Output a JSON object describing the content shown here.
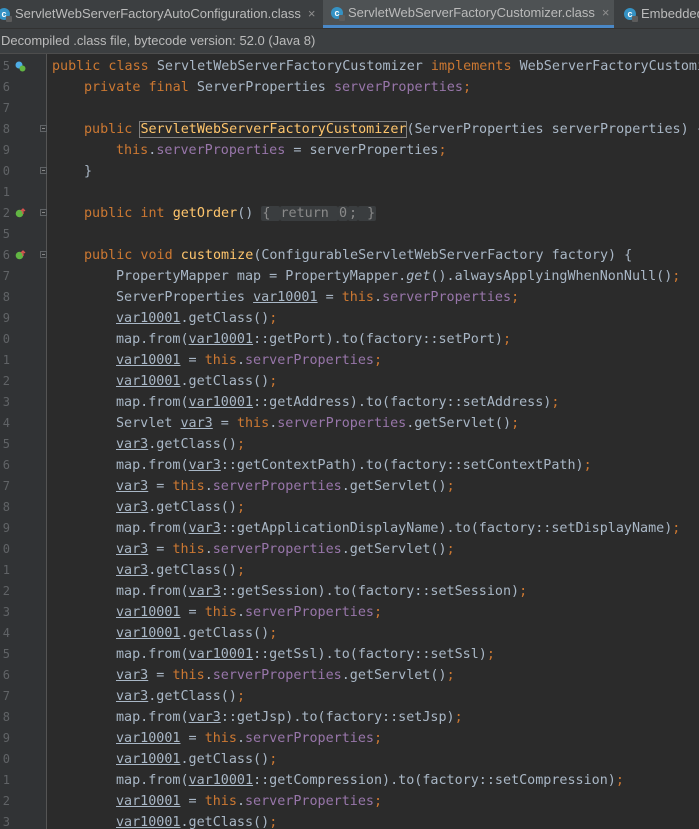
{
  "tabs": [
    {
      "label": "ServletWebServerFactoryAutoConfiguration.class",
      "active": false,
      "icon": "class-file-icon"
    },
    {
      "label": "ServletWebServerFactoryCustomizer.class",
      "active": true,
      "icon": "class-file-icon"
    },
    {
      "label": "EmbeddedServletContainerAutoConfiguration.class",
      "active": false,
      "icon": "class-file-icon"
    }
  ],
  "tab_close_glyph": "×",
  "tab_icon_glyph": "c",
  "banner": "Decompiled .class file, bytecode version: 52.0 (Java 8)",
  "colors": {
    "keyword": "#cc7832",
    "method": "#ffc66d",
    "field": "#9876aa",
    "number": "#6897bb",
    "text": "#a9b7c6",
    "background": "#2b2b2b",
    "accent": "#4a88c7"
  },
  "code_lines": [
    {
      "n": "15",
      "indent": 0,
      "tokens": [
        [
          "kw",
          "public class "
        ],
        [
          "t",
          "ServletWebServerFactoryCustomizer "
        ],
        [
          "kw",
          "implements "
        ],
        [
          "t",
          "WebServerFactoryCustomizer<ConfigurableServletWebServerFactory>, Ordered {"
        ]
      ]
    },
    {
      "n": "16",
      "indent": 1,
      "tokens": [
        [
          "kw",
          "private final "
        ],
        [
          "t",
          "ServerProperties "
        ],
        [
          "fld",
          "serverProperties"
        ],
        [
          "kw",
          ";"
        ]
      ]
    },
    {
      "n": "17",
      "indent": 0,
      "tokens": []
    },
    {
      "n": "18",
      "indent": 1,
      "tokens": [
        [
          "kw",
          "public "
        ],
        [
          "fn",
          "ServletWebServerFactoryCustomizer"
        ],
        [
          "t",
          "(ServerProperties serverProperties) {"
        ]
      ]
    },
    {
      "n": "19",
      "indent": 2,
      "tokens": [
        [
          "kw",
          "this"
        ],
        [
          "t",
          "."
        ],
        [
          "fld",
          "serverProperties"
        ],
        [
          "t",
          " = serverProperties"
        ],
        [
          "kw",
          ";"
        ]
      ]
    },
    {
      "n": "20",
      "indent": 1,
      "tokens": [
        [
          "t",
          "}"
        ]
      ]
    },
    {
      "n": "21",
      "indent": 0,
      "tokens": []
    },
    {
      "n": "22",
      "indent": 1,
      "tokens": [
        [
          "kw",
          "public int "
        ],
        [
          "fn",
          "getOrder"
        ],
        [
          "t",
          "() "
        ],
        [
          "col",
          "{ "
        ],
        [
          "kwc",
          "return "
        ],
        [
          "numc",
          "0"
        ],
        [
          "kwc",
          ";"
        ],
        [
          "col",
          " }"
        ]
      ]
    },
    {
      "n": "25",
      "indent": 0,
      "tokens": []
    },
    {
      "n": "26",
      "indent": 1,
      "tokens": [
        [
          "kw",
          "public void "
        ],
        [
          "fn",
          "customize"
        ],
        [
          "t",
          "(ConfigurableServletWebServerFactory factory) {"
        ]
      ]
    },
    {
      "n": "27",
      "indent": 2,
      "tokens": [
        [
          "t",
          "PropertyMapper map = PropertyMapper."
        ],
        [
          "it",
          "get"
        ],
        [
          "t",
          "().alwaysApplyingWhenNonNull()"
        ],
        [
          "kw",
          ";"
        ]
      ]
    },
    {
      "n": "28",
      "indent": 2,
      "tokens": [
        [
          "t",
          "ServerProperties "
        ],
        [
          "var",
          "var10001"
        ],
        [
          "t",
          " = "
        ],
        [
          "kw",
          "this"
        ],
        [
          "t",
          "."
        ],
        [
          "fld",
          "serverProperties"
        ],
        [
          "kw",
          ";"
        ]
      ]
    },
    {
      "n": "29",
      "indent": 2,
      "tokens": [
        [
          "var",
          "var10001"
        ],
        [
          "t",
          ".getClass()"
        ],
        [
          "kw",
          ";"
        ]
      ]
    },
    {
      "n": "30",
      "indent": 2,
      "tokens": [
        [
          "t",
          "map.from("
        ],
        [
          "var",
          "var10001"
        ],
        [
          "t",
          "::getPort).to(factory::setPort)"
        ],
        [
          "kw",
          ";"
        ]
      ]
    },
    {
      "n": "31",
      "indent": 2,
      "tokens": [
        [
          "var",
          "var10001"
        ],
        [
          "t",
          " = "
        ],
        [
          "kw",
          "this"
        ],
        [
          "t",
          "."
        ],
        [
          "fld",
          "serverProperties"
        ],
        [
          "kw",
          ";"
        ]
      ]
    },
    {
      "n": "32",
      "indent": 2,
      "tokens": [
        [
          "var",
          "var10001"
        ],
        [
          "t",
          ".getClass()"
        ],
        [
          "kw",
          ";"
        ]
      ]
    },
    {
      "n": "33",
      "indent": 2,
      "tokens": [
        [
          "t",
          "map.from("
        ],
        [
          "var",
          "var10001"
        ],
        [
          "t",
          "::getAddress).to(factory::setAddress)"
        ],
        [
          "kw",
          ";"
        ]
      ]
    },
    {
      "n": "34",
      "indent": 2,
      "tokens": [
        [
          "t",
          "Servlet "
        ],
        [
          "var",
          "var3"
        ],
        [
          "t",
          " = "
        ],
        [
          "kw",
          "this"
        ],
        [
          "t",
          "."
        ],
        [
          "fld",
          "serverProperties"
        ],
        [
          "t",
          ".getServlet()"
        ],
        [
          "kw",
          ";"
        ]
      ]
    },
    {
      "n": "35",
      "indent": 2,
      "tokens": [
        [
          "var",
          "var3"
        ],
        [
          "t",
          ".getClass()"
        ],
        [
          "kw",
          ";"
        ]
      ]
    },
    {
      "n": "36",
      "indent": 2,
      "tokens": [
        [
          "t",
          "map.from("
        ],
        [
          "var",
          "var3"
        ],
        [
          "t",
          "::getContextPath).to(factory::setContextPath)"
        ],
        [
          "kw",
          ";"
        ]
      ]
    },
    {
      "n": "37",
      "indent": 2,
      "tokens": [
        [
          "var",
          "var3"
        ],
        [
          "t",
          " = "
        ],
        [
          "kw",
          "this"
        ],
        [
          "t",
          "."
        ],
        [
          "fld",
          "serverProperties"
        ],
        [
          "t",
          ".getServlet()"
        ],
        [
          "kw",
          ";"
        ]
      ]
    },
    {
      "n": "38",
      "indent": 2,
      "tokens": [
        [
          "var",
          "var3"
        ],
        [
          "t",
          ".getClass()"
        ],
        [
          "kw",
          ";"
        ]
      ]
    },
    {
      "n": "39",
      "indent": 2,
      "tokens": [
        [
          "t",
          "map.from("
        ],
        [
          "var",
          "var3"
        ],
        [
          "t",
          "::getApplicationDisplayName).to(factory::setDisplayName)"
        ],
        [
          "kw",
          ";"
        ]
      ]
    },
    {
      "n": "40",
      "indent": 2,
      "tokens": [
        [
          "var",
          "var3"
        ],
        [
          "t",
          " = "
        ],
        [
          "kw",
          "this"
        ],
        [
          "t",
          "."
        ],
        [
          "fld",
          "serverProperties"
        ],
        [
          "t",
          ".getServlet()"
        ],
        [
          "kw",
          ";"
        ]
      ]
    },
    {
      "n": "41",
      "indent": 2,
      "tokens": [
        [
          "var",
          "var3"
        ],
        [
          "t",
          ".getClass()"
        ],
        [
          "kw",
          ";"
        ]
      ]
    },
    {
      "n": "42",
      "indent": 2,
      "tokens": [
        [
          "t",
          "map.from("
        ],
        [
          "var",
          "var3"
        ],
        [
          "t",
          "::getSession).to(factory::setSession)"
        ],
        [
          "kw",
          ";"
        ]
      ]
    },
    {
      "n": "43",
      "indent": 2,
      "tokens": [
        [
          "var",
          "var10001"
        ],
        [
          "t",
          " = "
        ],
        [
          "kw",
          "this"
        ],
        [
          "t",
          "."
        ],
        [
          "fld",
          "serverProperties"
        ],
        [
          "kw",
          ";"
        ]
      ]
    },
    {
      "n": "44",
      "indent": 2,
      "tokens": [
        [
          "var",
          "var10001"
        ],
        [
          "t",
          ".getClass()"
        ],
        [
          "kw",
          ";"
        ]
      ]
    },
    {
      "n": "45",
      "indent": 2,
      "tokens": [
        [
          "t",
          "map.from("
        ],
        [
          "var",
          "var10001"
        ],
        [
          "t",
          "::getSsl).to(factory::setSsl)"
        ],
        [
          "kw",
          ";"
        ]
      ]
    },
    {
      "n": "46",
      "indent": 2,
      "tokens": [
        [
          "var",
          "var3"
        ],
        [
          "t",
          " = "
        ],
        [
          "kw",
          "this"
        ],
        [
          "t",
          "."
        ],
        [
          "fld",
          "serverProperties"
        ],
        [
          "t",
          ".getServlet()"
        ],
        [
          "kw",
          ";"
        ]
      ]
    },
    {
      "n": "47",
      "indent": 2,
      "tokens": [
        [
          "var",
          "var3"
        ],
        [
          "t",
          ".getClass()"
        ],
        [
          "kw",
          ";"
        ]
      ]
    },
    {
      "n": "48",
      "indent": 2,
      "tokens": [
        [
          "t",
          "map.from("
        ],
        [
          "var",
          "var3"
        ],
        [
          "t",
          "::getJsp).to(factory::setJsp)"
        ],
        [
          "kw",
          ";"
        ]
      ]
    },
    {
      "n": "49",
      "indent": 2,
      "tokens": [
        [
          "var",
          "var10001"
        ],
        [
          "t",
          " = "
        ],
        [
          "kw",
          "this"
        ],
        [
          "t",
          "."
        ],
        [
          "fld",
          "serverProperties"
        ],
        [
          "kw",
          ";"
        ]
      ]
    },
    {
      "n": "50",
      "indent": 2,
      "tokens": [
        [
          "var",
          "var10001"
        ],
        [
          "t",
          ".getClass()"
        ],
        [
          "kw",
          ";"
        ]
      ]
    },
    {
      "n": "51",
      "indent": 2,
      "tokens": [
        [
          "t",
          "map.from("
        ],
        [
          "var",
          "var10001"
        ],
        [
          "t",
          "::getCompression).to(factory::setCompression)"
        ],
        [
          "kw",
          ";"
        ]
      ]
    },
    {
      "n": "52",
      "indent": 2,
      "tokens": [
        [
          "var",
          "var10001"
        ],
        [
          "t",
          " = "
        ],
        [
          "kw",
          "this"
        ],
        [
          "t",
          "."
        ],
        [
          "fld",
          "serverProperties"
        ],
        [
          "kw",
          ";"
        ]
      ]
    },
    {
      "n": "53",
      "indent": 2,
      "tokens": [
        [
          "var",
          "var10001"
        ],
        [
          "t",
          ".getClass()"
        ],
        [
          "kw",
          ";"
        ]
      ]
    }
  ]
}
